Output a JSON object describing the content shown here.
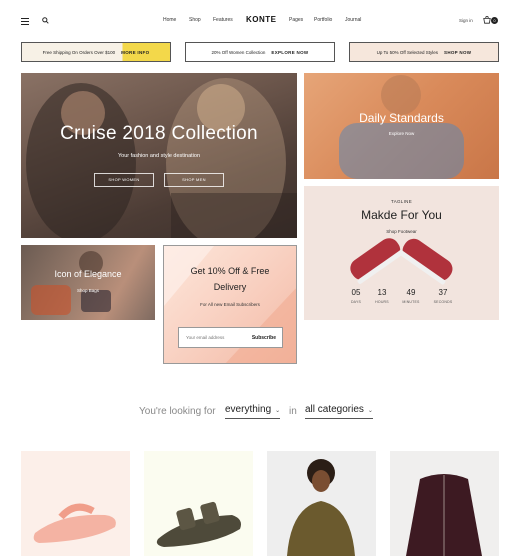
{
  "header": {
    "nav_left": [
      "Home",
      "Shop",
      "Features"
    ],
    "logo": "KONTE",
    "nav_right": [
      "Pages",
      "Portfolio",
      "Journal"
    ],
    "signin": "Sign in",
    "cart_count": "0"
  },
  "promos": [
    {
      "text": "Free Shipping On Orders Over $100",
      "cta": "MORE INFO"
    },
    {
      "text": "20% Off Women Collection",
      "cta": "EXPLORE NOW"
    },
    {
      "text": "Up To 50% Off Selected Styles",
      "cta": "SHOP NOW"
    }
  ],
  "hero": {
    "title": "Cruise 2018 Collection",
    "subtitle": "Your fashion and style destination",
    "btn_women": "SHOP WOMEN",
    "btn_men": "SHOP MEN"
  },
  "daily": {
    "title": "Daily Standards",
    "link": "Explore Now"
  },
  "makde": {
    "tag": "TAGLINE",
    "title": "Makde For You",
    "link": "Shop Footwear",
    "countdown": [
      {
        "value": "05",
        "label": "DAYS"
      },
      {
        "value": "13",
        "label": "HOURS"
      },
      {
        "value": "49",
        "label": "MINUTES"
      },
      {
        "value": "37",
        "label": "SECONDS"
      }
    ]
  },
  "elegance": {
    "title": "Icon of Elegance",
    "link": "Shop Bags"
  },
  "offer": {
    "title": "Get 10% Off & Free Delivery",
    "subtitle": "For All new Email Subscribers",
    "placeholder": "Your email address",
    "button": "Subscribe"
  },
  "filter": {
    "prefix": "You're looking for",
    "selection1": "everything",
    "connector": "in",
    "selection2": "all categories"
  }
}
